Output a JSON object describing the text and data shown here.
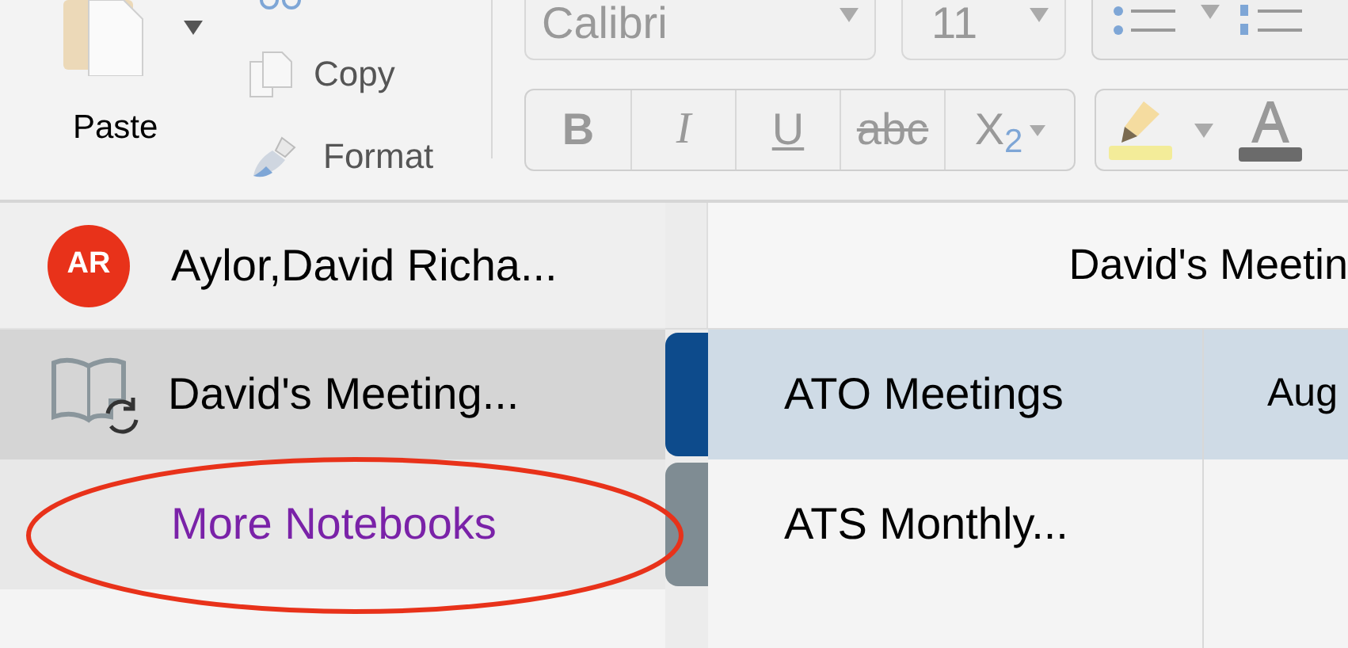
{
  "ribbon": {
    "paste": {
      "label": "Paste"
    },
    "clipboard": [
      {
        "kind": "copy",
        "label": "Copy"
      },
      {
        "kind": "format",
        "label": "Format"
      }
    ],
    "font": {
      "value": "Calibri"
    },
    "size": {
      "value": "11"
    },
    "format_buttons": [
      {
        "kind": "bold",
        "label": "B"
      },
      {
        "kind": "italic",
        "label": "I"
      },
      {
        "kind": "underline",
        "label": "U"
      },
      {
        "kind": "strike",
        "label": "abc"
      },
      {
        "kind": "subscript",
        "label": "X$_{2}$"
      }
    ]
  },
  "sidebar": {
    "account": {
      "initials": "AR",
      "name": "Aylor,David Richa..."
    },
    "notebooks": [
      {
        "name": "David's Meeting...",
        "selected": true
      }
    ],
    "more_link": "More Notebooks"
  },
  "notebook_title": "David's Meetin",
  "sections": [
    {
      "name": "ATO Meetings",
      "selected": true,
      "color": "#0d4b8c"
    },
    {
      "name": "ATS Monthly...",
      "selected": false,
      "color": "#7f8c93"
    }
  ],
  "pages": [
    {
      "title": "Aug",
      "selected": true
    }
  ],
  "annotations": [
    {
      "kind": "ellipse"
    }
  ]
}
